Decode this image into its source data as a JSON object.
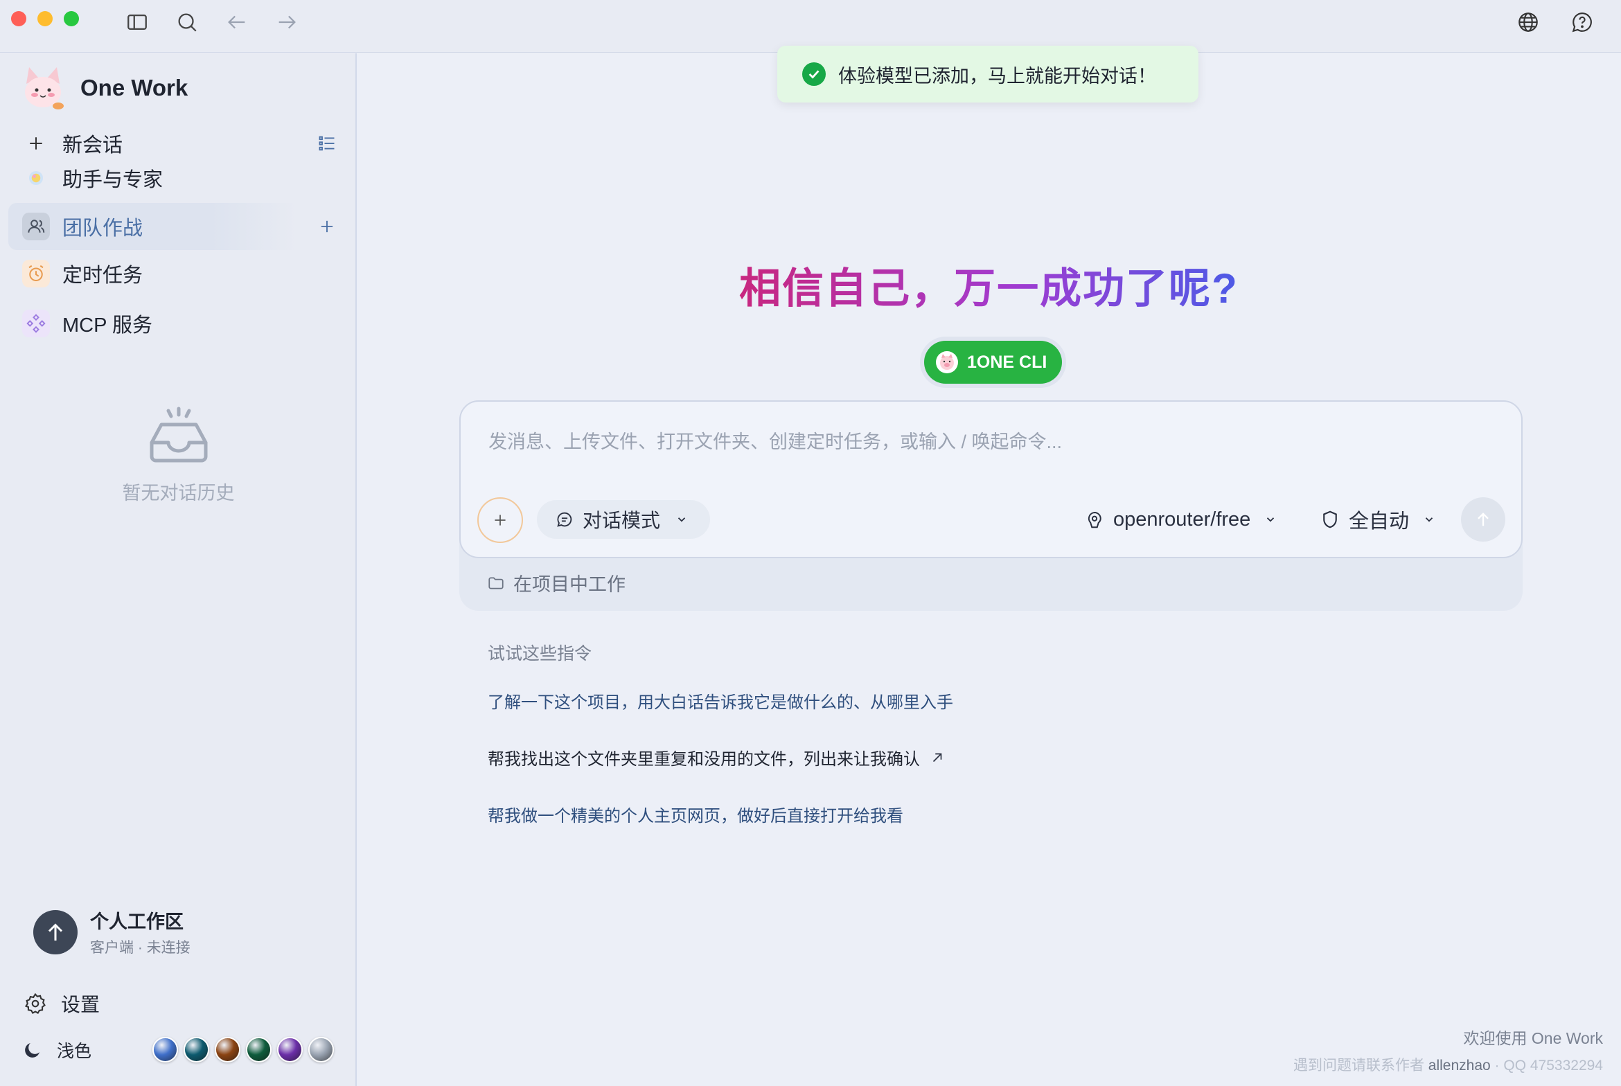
{
  "sidebar": {
    "brand": "One Work",
    "items": [
      {
        "label": "新会话"
      },
      {
        "label": "助手与专家"
      },
      {
        "label": "团队作战"
      },
      {
        "label": "定时任务"
      },
      {
        "label": "MCP 服务"
      }
    ],
    "empty_history": "暂无对话历史",
    "workspace": {
      "title": "个人工作区",
      "subtitle": "客户端 · 未连接"
    },
    "settings_label": "设置",
    "theme_label": "浅色",
    "theme_swatches": [
      "#3f6fc9",
      "#0d5a6e",
      "#8a4312",
      "#0f5c3c",
      "#6b2fa8",
      "#9aa4b2"
    ]
  },
  "toast": {
    "text": "体验模型已添加，马上就能开始对话！",
    "color": "#17a847"
  },
  "main": {
    "hero": "相信自己，万一成功了呢?",
    "cli_label": "1ONE CLI",
    "composer": {
      "placeholder": "发消息、上传文件、打开文件夹、创建定时任务，或输入 / 唤起命令...",
      "mode_label": "对话模式",
      "model_label": "openrouter/free",
      "auto_label": "全自动",
      "project_label": "在项目中工作"
    },
    "suggestions_title": "试试这些指令",
    "suggestions": [
      "了解一下这个项目，用大白话告诉我它是做什么的、从哪里入手",
      "帮我找出这个文件夹里重复和没用的文件，列出来让我确认",
      "帮我做一个精美的个人主页网页，做好后直接打开给我看"
    ]
  },
  "footer": {
    "welcome": "欢迎使用 One Work",
    "contact_prefix": "遇到问题请联系作者",
    "author": "allenzhao",
    "qq": "QQ 475332294"
  },
  "colors": {
    "accent": "#4a6fa5",
    "cli_green": "#28b342",
    "hero_from": "#c8277f",
    "hero_to": "#4d5ae6"
  }
}
